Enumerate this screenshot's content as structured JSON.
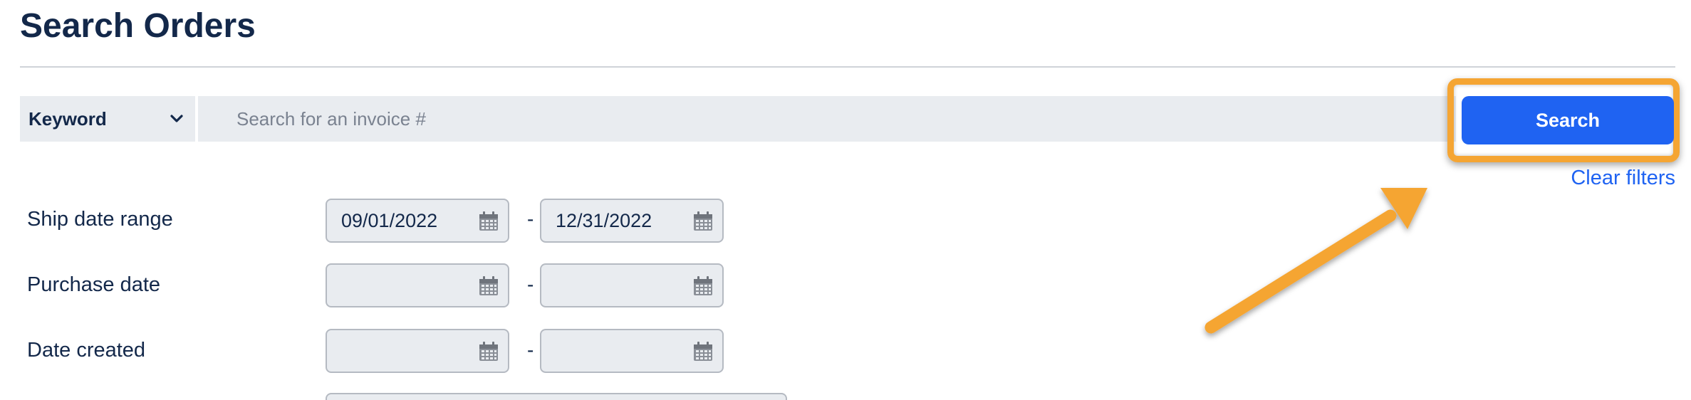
{
  "page": {
    "title": "Search Orders"
  },
  "search": {
    "type_select": "Keyword",
    "placeholder": "Search for an invoice #",
    "value": "",
    "button_label": "Search",
    "clear_label": "Clear filters"
  },
  "filters": {
    "separator": "-",
    "rows": [
      {
        "label": "Ship date range",
        "from": "09/01/2022",
        "to": "12/31/2022"
      },
      {
        "label": "Purchase date",
        "from": "",
        "to": ""
      },
      {
        "label": "Date created",
        "from": "",
        "to": ""
      }
    ]
  },
  "icons": {
    "dropdown": "chevron-down-icon",
    "date": "calendar-icon",
    "annotation": "arrow-annotation"
  },
  "colors": {
    "primary": "#1f63f2",
    "title": "#13284a",
    "field_bg": "#e9ecf0",
    "highlight": "#f5a533"
  }
}
